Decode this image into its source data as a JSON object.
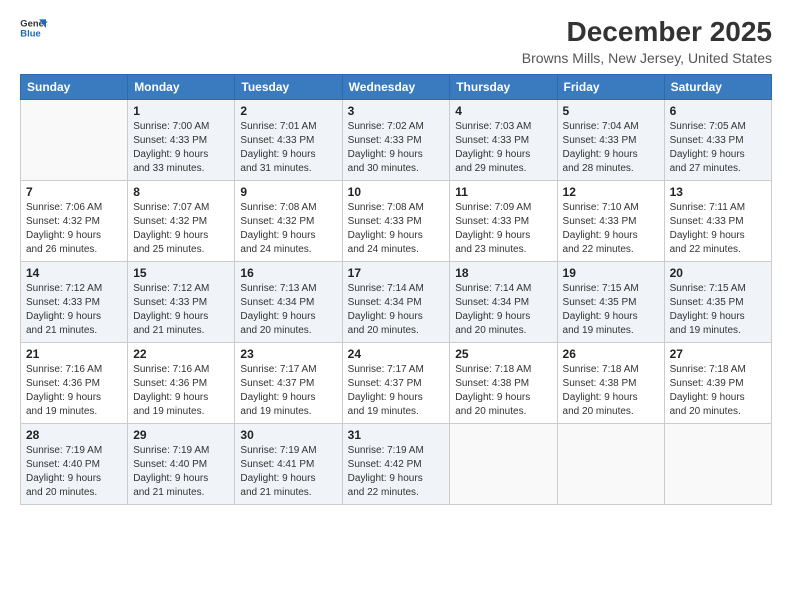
{
  "logo": {
    "line1": "General",
    "line2": "Blue"
  },
  "title": "December 2025",
  "subtitle": "Browns Mills, New Jersey, United States",
  "days_header": [
    "Sunday",
    "Monday",
    "Tuesday",
    "Wednesday",
    "Thursday",
    "Friday",
    "Saturday"
  ],
  "weeks": [
    [
      {
        "day": "",
        "info": ""
      },
      {
        "day": "1",
        "info": "Sunrise: 7:00 AM\nSunset: 4:33 PM\nDaylight: 9 hours\nand 33 minutes."
      },
      {
        "day": "2",
        "info": "Sunrise: 7:01 AM\nSunset: 4:33 PM\nDaylight: 9 hours\nand 31 minutes."
      },
      {
        "day": "3",
        "info": "Sunrise: 7:02 AM\nSunset: 4:33 PM\nDaylight: 9 hours\nand 30 minutes."
      },
      {
        "day": "4",
        "info": "Sunrise: 7:03 AM\nSunset: 4:33 PM\nDaylight: 9 hours\nand 29 minutes."
      },
      {
        "day": "5",
        "info": "Sunrise: 7:04 AM\nSunset: 4:33 PM\nDaylight: 9 hours\nand 28 minutes."
      },
      {
        "day": "6",
        "info": "Sunrise: 7:05 AM\nSunset: 4:33 PM\nDaylight: 9 hours\nand 27 minutes."
      }
    ],
    [
      {
        "day": "7",
        "info": "Sunrise: 7:06 AM\nSunset: 4:32 PM\nDaylight: 9 hours\nand 26 minutes."
      },
      {
        "day": "8",
        "info": "Sunrise: 7:07 AM\nSunset: 4:32 PM\nDaylight: 9 hours\nand 25 minutes."
      },
      {
        "day": "9",
        "info": "Sunrise: 7:08 AM\nSunset: 4:32 PM\nDaylight: 9 hours\nand 24 minutes."
      },
      {
        "day": "10",
        "info": "Sunrise: 7:08 AM\nSunset: 4:33 PM\nDaylight: 9 hours\nand 24 minutes."
      },
      {
        "day": "11",
        "info": "Sunrise: 7:09 AM\nSunset: 4:33 PM\nDaylight: 9 hours\nand 23 minutes."
      },
      {
        "day": "12",
        "info": "Sunrise: 7:10 AM\nSunset: 4:33 PM\nDaylight: 9 hours\nand 22 minutes."
      },
      {
        "day": "13",
        "info": "Sunrise: 7:11 AM\nSunset: 4:33 PM\nDaylight: 9 hours\nand 22 minutes."
      }
    ],
    [
      {
        "day": "14",
        "info": "Sunrise: 7:12 AM\nSunset: 4:33 PM\nDaylight: 9 hours\nand 21 minutes."
      },
      {
        "day": "15",
        "info": "Sunrise: 7:12 AM\nSunset: 4:33 PM\nDaylight: 9 hours\nand 21 minutes."
      },
      {
        "day": "16",
        "info": "Sunrise: 7:13 AM\nSunset: 4:34 PM\nDaylight: 9 hours\nand 20 minutes."
      },
      {
        "day": "17",
        "info": "Sunrise: 7:14 AM\nSunset: 4:34 PM\nDaylight: 9 hours\nand 20 minutes."
      },
      {
        "day": "18",
        "info": "Sunrise: 7:14 AM\nSunset: 4:34 PM\nDaylight: 9 hours\nand 20 minutes."
      },
      {
        "day": "19",
        "info": "Sunrise: 7:15 AM\nSunset: 4:35 PM\nDaylight: 9 hours\nand 19 minutes."
      },
      {
        "day": "20",
        "info": "Sunrise: 7:15 AM\nSunset: 4:35 PM\nDaylight: 9 hours\nand 19 minutes."
      }
    ],
    [
      {
        "day": "21",
        "info": "Sunrise: 7:16 AM\nSunset: 4:36 PM\nDaylight: 9 hours\nand 19 minutes."
      },
      {
        "day": "22",
        "info": "Sunrise: 7:16 AM\nSunset: 4:36 PM\nDaylight: 9 hours\nand 19 minutes."
      },
      {
        "day": "23",
        "info": "Sunrise: 7:17 AM\nSunset: 4:37 PM\nDaylight: 9 hours\nand 19 minutes."
      },
      {
        "day": "24",
        "info": "Sunrise: 7:17 AM\nSunset: 4:37 PM\nDaylight: 9 hours\nand 19 minutes."
      },
      {
        "day": "25",
        "info": "Sunrise: 7:18 AM\nSunset: 4:38 PM\nDaylight: 9 hours\nand 20 minutes."
      },
      {
        "day": "26",
        "info": "Sunrise: 7:18 AM\nSunset: 4:38 PM\nDaylight: 9 hours\nand 20 minutes."
      },
      {
        "day": "27",
        "info": "Sunrise: 7:18 AM\nSunset: 4:39 PM\nDaylight: 9 hours\nand 20 minutes."
      }
    ],
    [
      {
        "day": "28",
        "info": "Sunrise: 7:19 AM\nSunset: 4:40 PM\nDaylight: 9 hours\nand 20 minutes."
      },
      {
        "day": "29",
        "info": "Sunrise: 7:19 AM\nSunset: 4:40 PM\nDaylight: 9 hours\nand 21 minutes."
      },
      {
        "day": "30",
        "info": "Sunrise: 7:19 AM\nSunset: 4:41 PM\nDaylight: 9 hours\nand 21 minutes."
      },
      {
        "day": "31",
        "info": "Sunrise: 7:19 AM\nSunset: 4:42 PM\nDaylight: 9 hours\nand 22 minutes."
      },
      {
        "day": "",
        "info": ""
      },
      {
        "day": "",
        "info": ""
      },
      {
        "day": "",
        "info": ""
      }
    ]
  ]
}
